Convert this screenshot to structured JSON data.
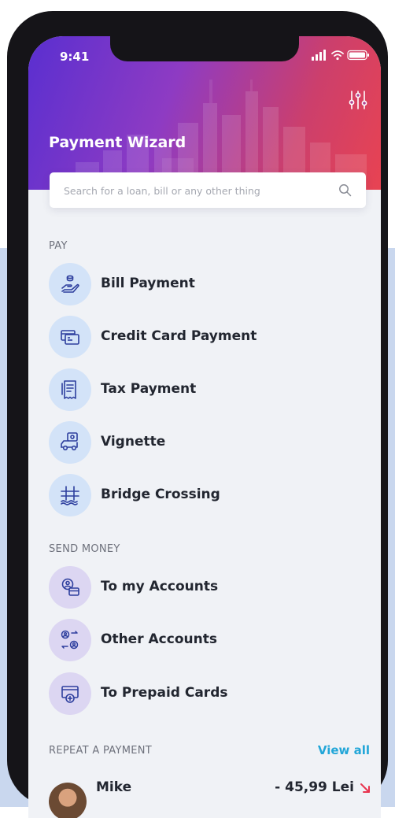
{
  "status_bar": {
    "time": "9:41"
  },
  "header": {
    "title": "Payment Wizard",
    "filter_icon": "sliders-icon"
  },
  "search": {
    "placeholder": "Search for a loan, bill or any other thing",
    "icon": "search-icon"
  },
  "pay": {
    "label": "PAY",
    "items": [
      {
        "label": "Bill Payment",
        "icon": "hand-coins-icon"
      },
      {
        "label": "Credit Card Payment",
        "icon": "credit-card-icon"
      },
      {
        "label": "Tax Payment",
        "icon": "receipt-icon"
      },
      {
        "label": "Vignette",
        "icon": "car-sticker-icon"
      },
      {
        "label": "Bridge Crossing",
        "icon": "bridge-icon"
      }
    ]
  },
  "send_money": {
    "label": "SEND MONEY",
    "items": [
      {
        "label": "To my Accounts",
        "icon": "account-transfer-icon"
      },
      {
        "label": "Other Accounts",
        "icon": "people-exchange-icon"
      },
      {
        "label": "To Prepaid Cards",
        "icon": "prepaid-card-icon"
      }
    ]
  },
  "repeat": {
    "label": "REPEAT A PAYMENT",
    "view_all": "View all",
    "items": [
      {
        "name": "Mike",
        "amount": "- 45,99 Lei",
        "direction": "outgoing"
      }
    ]
  },
  "colors": {
    "accent": "#22a6d8",
    "header_gradient_start": "#5a2fd0",
    "header_gradient_end": "#e84352",
    "pay_icon_bg": "#d3e3f8",
    "send_icon_bg": "#dcd6f2",
    "icon_stroke": "#2e3f9e",
    "negative": "#e8354f"
  }
}
